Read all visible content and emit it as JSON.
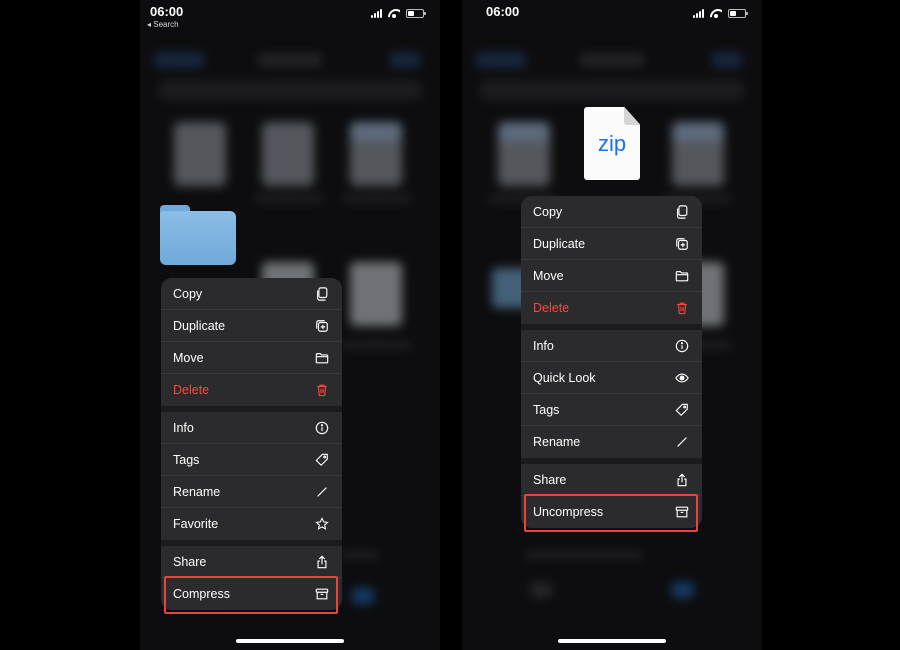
{
  "left": {
    "status": {
      "time": "06:00",
      "back": "◂ Search"
    },
    "menu": {
      "groups": [
        [
          {
            "label": "Copy",
            "icon": "copy-icon"
          },
          {
            "label": "Duplicate",
            "icon": "duplicate-icon"
          },
          {
            "label": "Move",
            "icon": "folder-icon"
          },
          {
            "label": "Delete",
            "icon": "trash-icon",
            "danger": true
          }
        ],
        [
          {
            "label": "Info",
            "icon": "info-icon"
          },
          {
            "label": "Tags",
            "icon": "tag-icon"
          },
          {
            "label": "Rename",
            "icon": "pencil-icon"
          },
          {
            "label": "Favorite",
            "icon": "star-icon"
          }
        ],
        [
          {
            "label": "Share",
            "icon": "share-icon"
          },
          {
            "label": "Compress",
            "icon": "archive-icon",
            "highlighted": true
          }
        ]
      ]
    }
  },
  "right": {
    "status": {
      "time": "06:00"
    },
    "file_icon_label": "zip",
    "menu": {
      "groups": [
        [
          {
            "label": "Copy",
            "icon": "copy-icon"
          },
          {
            "label": "Duplicate",
            "icon": "duplicate-icon"
          },
          {
            "label": "Move",
            "icon": "folder-icon"
          },
          {
            "label": "Delete",
            "icon": "trash-icon",
            "danger": true
          }
        ],
        [
          {
            "label": "Info",
            "icon": "info-icon"
          },
          {
            "label": "Quick Look",
            "icon": "eye-icon"
          },
          {
            "label": "Tags",
            "icon": "tag-icon"
          },
          {
            "label": "Rename",
            "icon": "pencil-icon"
          }
        ],
        [
          {
            "label": "Share",
            "icon": "share-icon"
          },
          {
            "label": "Uncompress",
            "icon": "archive-icon",
            "highlighted": true
          }
        ]
      ]
    }
  },
  "colors": {
    "danger": "#ff453a",
    "highlight": "#e8443a",
    "zip_blue": "#1a73e8",
    "folder_blue": "#6ea9d9"
  }
}
